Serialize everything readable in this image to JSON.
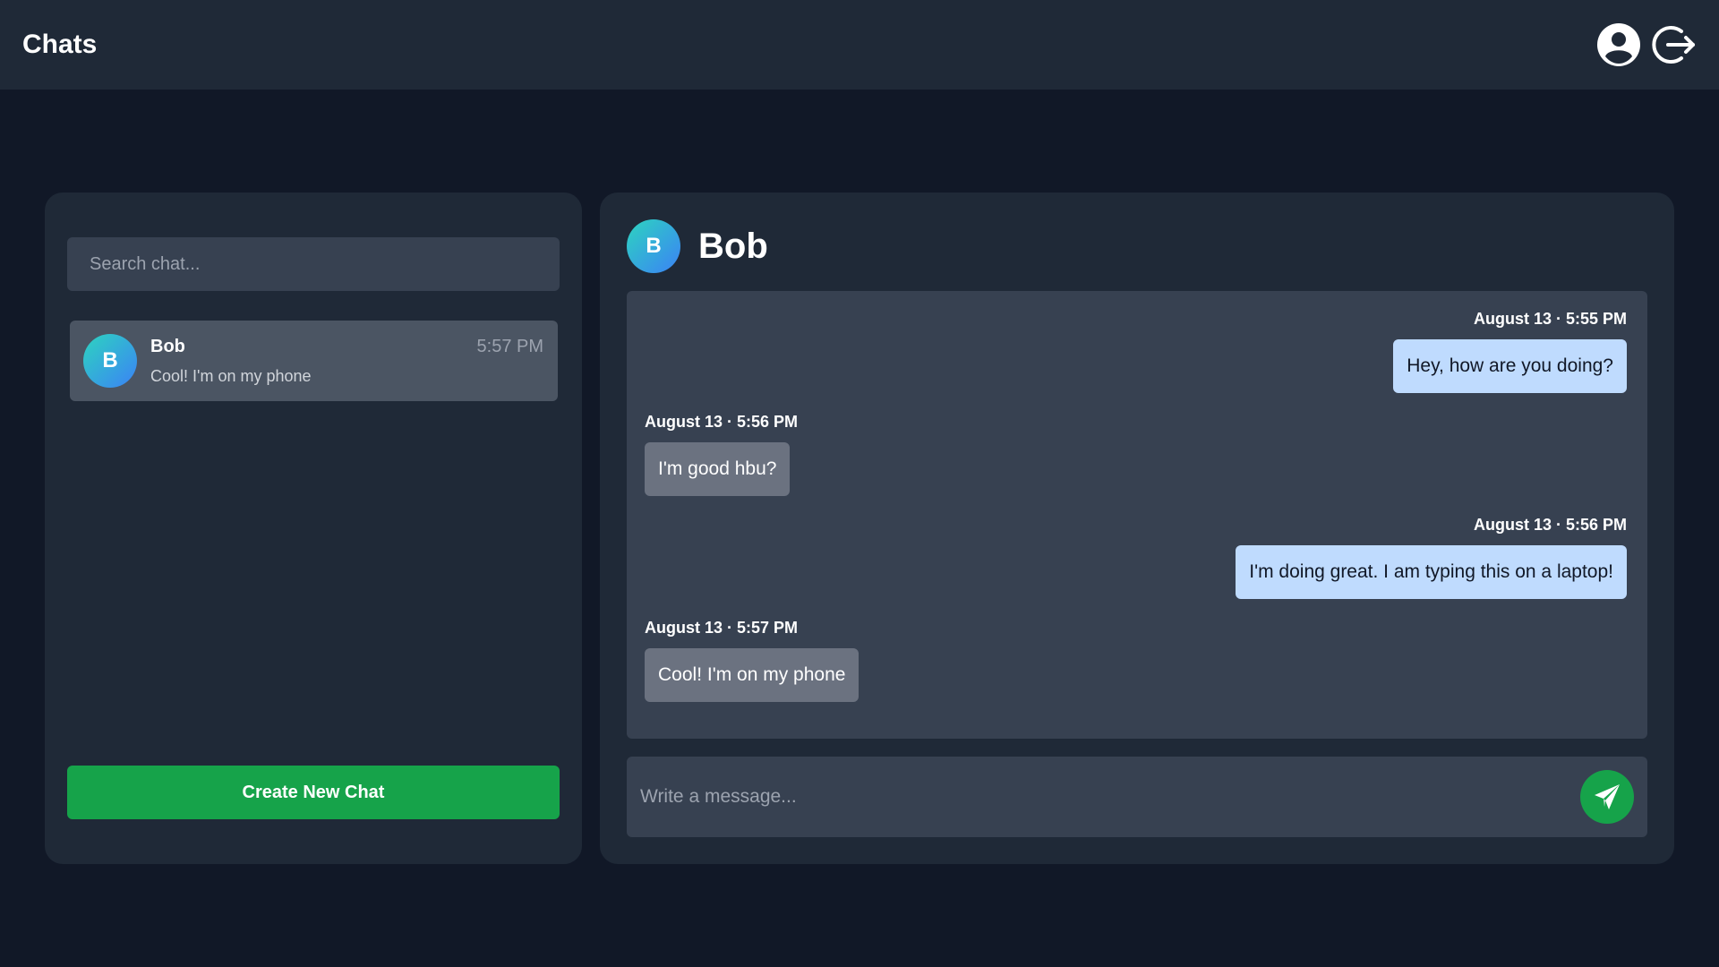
{
  "app": {
    "title": "Chats",
    "icons": {
      "profile": "user-circle-icon",
      "logout": "logout-icon",
      "send": "paper-plane-icon"
    }
  },
  "colors": {
    "background": "#111827",
    "panel": "#1f2937",
    "field": "#374151",
    "selected_item": "#4b5563",
    "accent_green": "#16a34a",
    "sent_bubble": "#bfdbfe",
    "received_bubble": "#6b7280"
  },
  "sidebar": {
    "search_placeholder": "Search chat...",
    "chats": [
      {
        "initial": "B",
        "name": "Bob",
        "time": "5:57 PM",
        "preview": "Cool! I'm on my phone"
      }
    ],
    "create_button_label": "Create New Chat"
  },
  "chat": {
    "contact_initial": "B",
    "contact_name": "Bob",
    "messages": [
      {
        "direction": "sent",
        "timestamp": "August 13 · 5:55 PM",
        "text": "Hey, how are you doing?"
      },
      {
        "direction": "received",
        "timestamp": "August 13 · 5:56 PM",
        "text": "I'm good hbu?"
      },
      {
        "direction": "sent",
        "timestamp": "August 13 · 5:56 PM",
        "text": "I'm doing great. I am typing this on a laptop!"
      },
      {
        "direction": "received",
        "timestamp": "August 13 · 5:57 PM",
        "text": "Cool! I'm on my phone"
      }
    ],
    "composer_placeholder": "Write a message..."
  }
}
